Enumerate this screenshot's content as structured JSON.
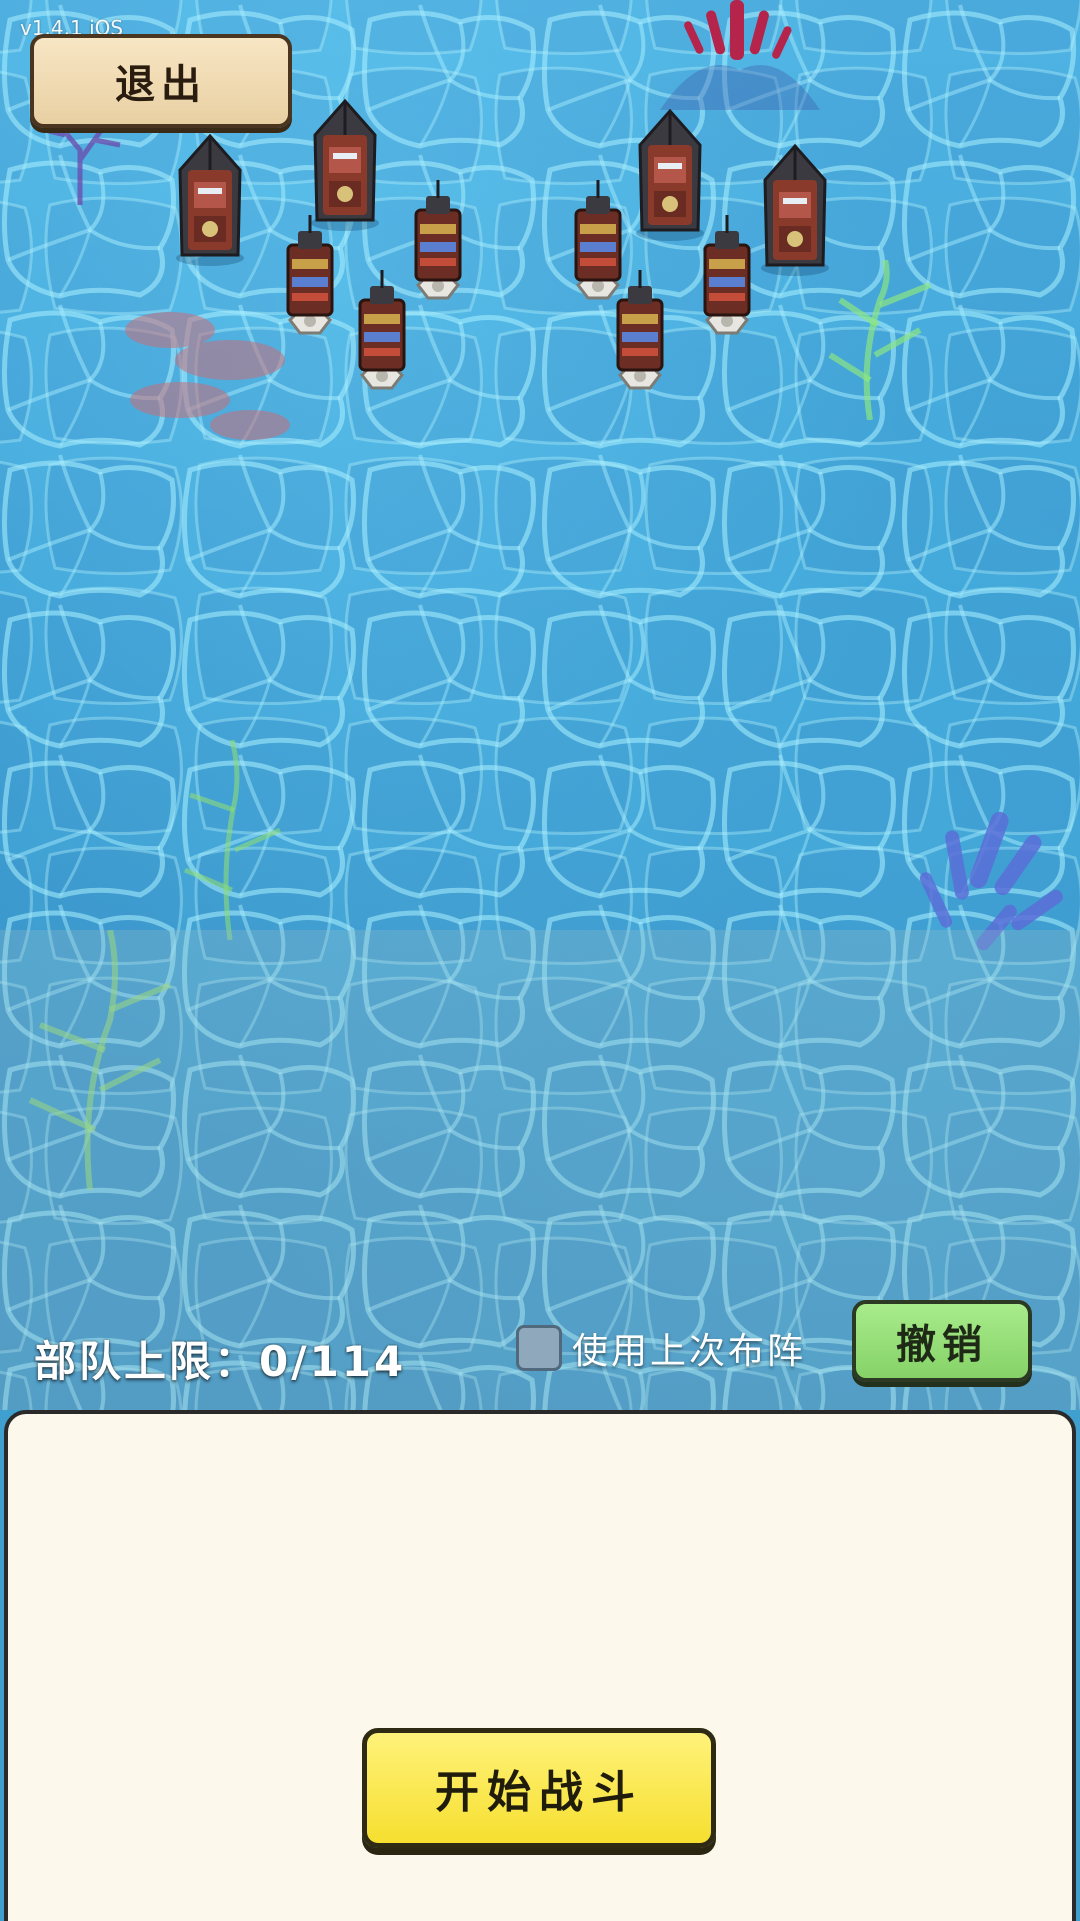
{
  "version": "v1.4.1 iOS",
  "header": {
    "exit_label": "退出"
  },
  "toolbar": {
    "troop_limit_label": "部队上限：",
    "troop_limit_value": "0/114",
    "use_last_formation_label": "使用上次布阵",
    "use_last_formation_checked": false,
    "undo_label": "撤销"
  },
  "panel": {
    "start_battle_label": "开始战斗"
  },
  "colors": {
    "water": "#3ea2d6",
    "panel_bg": "#fdf8ec",
    "exit_button": "#ecd6ab",
    "undo_button": "#96df78",
    "start_button": "#f8e63d",
    "ship_hull": "#8a3a2a"
  },
  "scene": {
    "enemy_ships": [
      "battleship",
      "battleship",
      "battleship",
      "battleship",
      "tower-ship",
      "tower-ship",
      "tower-ship",
      "tower-ship",
      "tower-ship",
      "tower-ship"
    ]
  }
}
